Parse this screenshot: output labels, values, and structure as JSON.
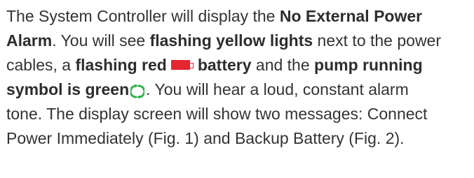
{
  "colors": {
    "text": "#333333",
    "battery_red": "#e3262f",
    "pump_green": "#2fb24a"
  },
  "icons": {
    "battery": "battery-icon",
    "pump": "pump-running-icon"
  },
  "paragraph": {
    "l1_a": "The System Controller will display the ",
    "l1_b": "No External Power",
    "l2_a": "Alarm",
    "l2_b": ". You will see ",
    "l2_c": "flashing yellow lights",
    "l2_d": " next to the power",
    "l3_a": "cables, a ",
    "l3_b": "flashing red",
    "l3_c": "battery",
    "l3_d": " and the ",
    "l3_e": "pump running",
    "l4_a": "symbol is green",
    "l4_b": ". You will hear a loud, constant alarm",
    "l5": "tone. The display screen will show two messages: Connect",
    "l6": "Power Immediately (Fig. 1) and Backup Battery (Fig. 2)."
  }
}
